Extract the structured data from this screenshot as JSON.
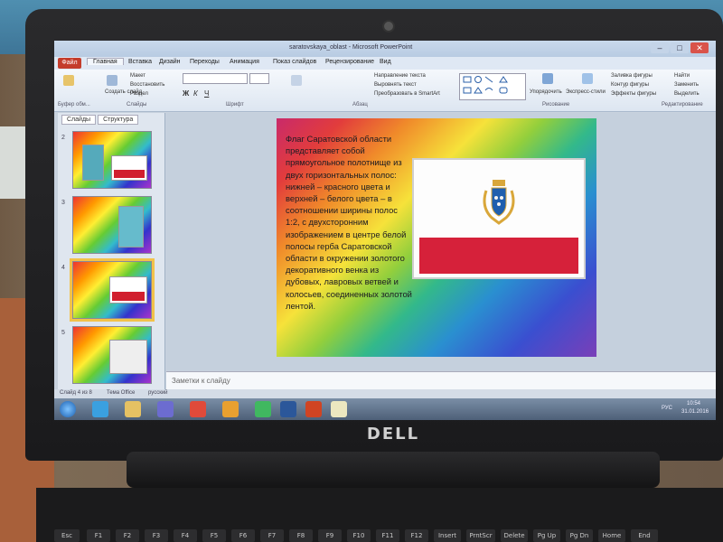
{
  "window": {
    "title": "saratovskaya_oblast - Microsoft PowerPoint",
    "minimize": "–",
    "maximize": "□",
    "close": "✕"
  },
  "ribbon": {
    "file_tab": "Файл",
    "tabs": [
      "Главная",
      "Вставка",
      "Дизайн",
      "Переходы",
      "Анимация",
      "Показ слайдов",
      "Рецензирование",
      "Вид"
    ],
    "groups": [
      "Буфер обм...",
      "Слайды",
      "Шрифт",
      "Абзац",
      "Рисование",
      "Редактирование"
    ],
    "buttons": {
      "create_slide": "Создать слайд",
      "layout": "Макет",
      "reset": "Восстановить",
      "section": "Раздел",
      "text_direction": "Направление текста",
      "align_text": "Выровнять текст",
      "smartart": "Преобразовать в SmartArt",
      "arrange": "Упорядочить",
      "quick_styles": "Экспресс-стили",
      "shape_fill": "Заливка фигуры",
      "shape_outline": "Контур фигуры",
      "shape_effects": "Эффекты фигуры",
      "find": "Найти",
      "replace": "Заменить",
      "select": "Выделить"
    }
  },
  "pane": {
    "tabs": [
      "Слайды",
      "Структура"
    ],
    "thumbnails": [
      {
        "num": "2"
      },
      {
        "num": "3"
      },
      {
        "num": "4",
        "selected": true
      },
      {
        "num": "5"
      }
    ]
  },
  "slide": {
    "text": "Флаг Саратовской области представляет собой прямоугольное полотнище из двух горизонтальных полос: нижней – красного цвета и верхней – белого цвета – в соотношении ширины полос 1:2, с двухсторонним изображением в центре белой полосы герба Саратовской области в окружении золотого декоративного венка из дубовых, лавровых ветвей и колосьев, соединенных золотой лентой.",
    "flag_colors": {
      "white": "#fdfdfd",
      "red": "#d6213a",
      "coat_blue": "#1f5fae",
      "coat_gold": "#d9a73a"
    }
  },
  "notes": {
    "placeholder": "Заметки к слайду"
  },
  "status": {
    "slide_info": "Слайд 4 из 8",
    "theme": "Тема Office",
    "language": "русский"
  },
  "taskbar": {
    "lang": "РУС",
    "time": "10:54",
    "date": "31.01.2016"
  },
  "device": {
    "brand": "DELL"
  },
  "keys": [
    "Esc",
    "F1",
    "F2",
    "F3",
    "F4",
    "F5",
    "F6",
    "F7",
    "F8",
    "F9",
    "F10",
    "F11",
    "F12",
    "Insert",
    "PrntScr",
    "Delete",
    "Pg Up",
    "Pg Dn",
    "Home",
    "End"
  ]
}
